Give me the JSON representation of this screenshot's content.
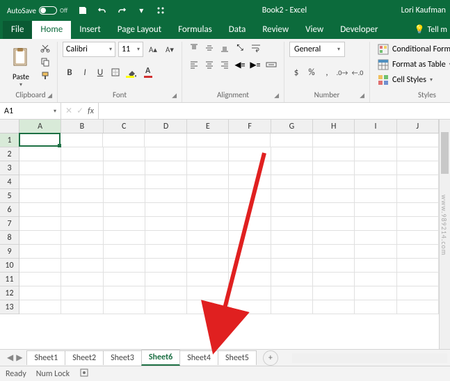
{
  "titlebar": {
    "autosave_label": "AutoSave",
    "autosave_state": "Off",
    "title": "Book2 - Excel",
    "user": "Lori Kaufman"
  },
  "tabs": {
    "file": "File",
    "home": "Home",
    "insert": "Insert",
    "page_layout": "Page Layout",
    "formulas": "Formulas",
    "data": "Data",
    "review": "Review",
    "view": "View",
    "developer": "Developer",
    "tell_me": "Tell m"
  },
  "ribbon": {
    "clipboard": {
      "label": "Clipboard",
      "paste": "Paste"
    },
    "font": {
      "label": "Font",
      "name": "Calibri",
      "size": "11",
      "bold": "B",
      "italic": "I",
      "underline": "U"
    },
    "alignment": {
      "label": "Alignment"
    },
    "number": {
      "label": "Number",
      "format": "General"
    },
    "styles": {
      "label": "Styles",
      "conditional": "Conditional Formatting",
      "table": "Format as Table",
      "cell": "Cell Styles"
    }
  },
  "formula_bar": {
    "name_box": "A1",
    "fx": "fx"
  },
  "grid": {
    "columns": [
      "A",
      "B",
      "C",
      "D",
      "E",
      "F",
      "G",
      "H",
      "I",
      "J"
    ],
    "rows": [
      "1",
      "2",
      "3",
      "4",
      "5",
      "6",
      "7",
      "8",
      "9",
      "10",
      "11",
      "12",
      "13"
    ],
    "active_cell": "A1"
  },
  "sheets": {
    "items": [
      {
        "label": "Sheet1",
        "active": false
      },
      {
        "label": "Sheet2",
        "active": false
      },
      {
        "label": "Sheet3",
        "active": false
      },
      {
        "label": "Sheet6",
        "active": true
      },
      {
        "label": "Sheet4",
        "active": false
      },
      {
        "label": "Sheet5",
        "active": false
      }
    ],
    "new": "+"
  },
  "status": {
    "ready": "Ready",
    "numlock": "Num Lock"
  },
  "watermark": "www.989214.com"
}
